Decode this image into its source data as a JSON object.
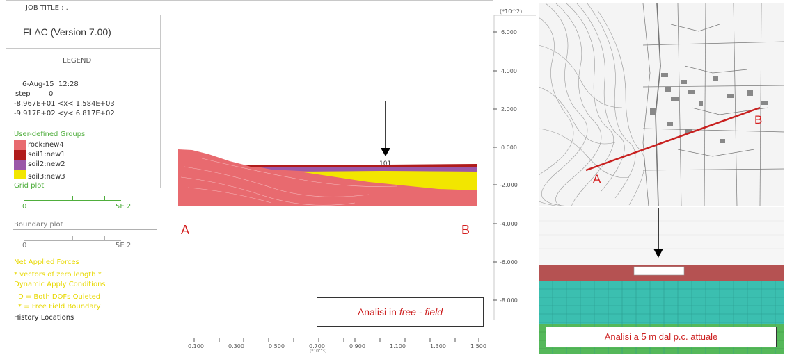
{
  "header": {
    "job_title": "JOB TITLE : ."
  },
  "app": {
    "name": "FLAC (Version 7.00)"
  },
  "legend": {
    "heading": "LEGEND",
    "date": "6-Aug-15  12:28",
    "step_label": "step",
    "step_value": "0",
    "x_range": "-8.967E+01 <x< 1.584E+03",
    "y_range": "-9.917E+02 <y< 6.817E+02"
  },
  "groups": {
    "heading": "User-defined Groups",
    "items": [
      {
        "label": "rock:new4",
        "color": "#e86a6f"
      },
      {
        "label": "soil1:new1",
        "color": "#b01c1c"
      },
      {
        "label": "soil2:new2",
        "color": "#9b58a8"
      },
      {
        "label": "soil3:new3",
        "color": "#f2e600"
      }
    ]
  },
  "grid_plot": {
    "label": "Grid plot",
    "min": "0",
    "max": "5E 2"
  },
  "boundary_plot": {
    "label": "Boundary plot",
    "min": "0",
    "max": "5E 2"
  },
  "forces": {
    "heading": "Net Applied Forces",
    "zero_vectors": "* vectors of zero length *",
    "dynamic": "Dynamic Apply Conditions",
    "both_quieted": "D = Both DOFs Quieted",
    "free_field": "* = Free Field Boundary"
  },
  "history": {
    "label": "History Locations"
  },
  "plot": {
    "y_scale": "(*10^2)",
    "y_ticks": [
      "6.000",
      "4.000",
      "2.000",
      "0.000",
      "-2.000",
      "-4.000",
      "-6.000",
      "-8.000"
    ],
    "x_ticks": [
      "0.100",
      "0.300",
      "0.500",
      "0.700",
      "0.900",
      "1.100",
      "1.300",
      "1.500"
    ],
    "x_scale": "(*10^3)",
    "history_point": "101",
    "point_a": "A",
    "point_b": "B",
    "caption_prefix": "Analisi in ",
    "caption_italic": "free - field"
  },
  "map": {
    "point_a": "A",
    "point_b": "B",
    "section_color": "#c8201f"
  },
  "model": {
    "caption": "Analisi a 5 m dal p.c. attuale"
  }
}
